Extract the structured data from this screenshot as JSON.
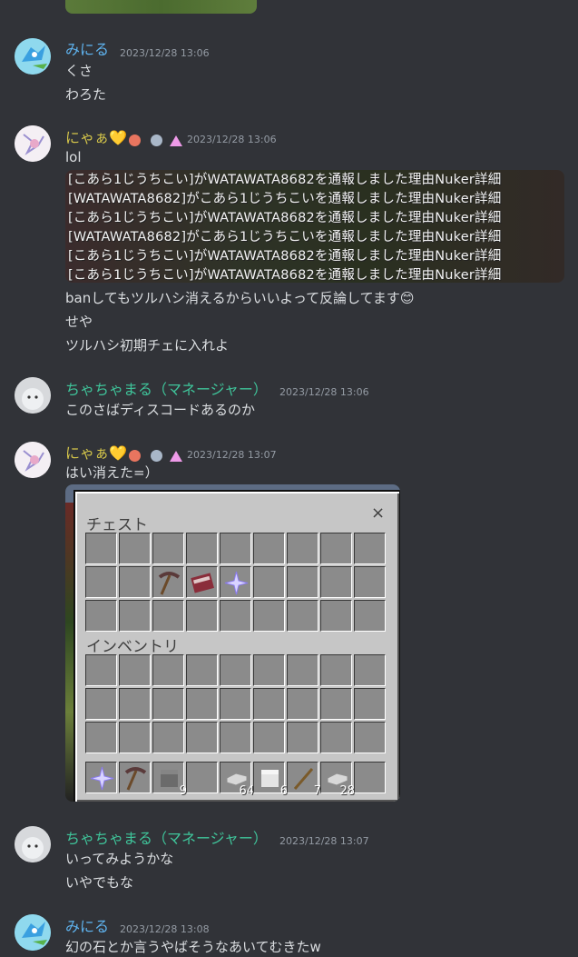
{
  "messages": [
    {
      "author": "みにる",
      "timestamp": "2023/12/28 13:06",
      "lines": [
        "くさ",
        "わろた"
      ]
    },
    {
      "author": "にゃぁ💛",
      "timestamp": "2023/12/28 13:06",
      "lines": [
        "lol",
        "banしてもツルハシ消えるからいいよって反論してます😊",
        "せや",
        "ツルハシ初期チェに入れよ"
      ],
      "log_lines": [
        "[こあら1じうちこい]がWATAWATA8682を通報しました理由Nuker詳細",
        "[WATAWATA8682]がこあら1じうちこいを通報しました理由Nuker詳細",
        "[こあら1じうちこい]がWATAWATA8682を通報しました理由Nuker詳細",
        "[WATAWATA8682]がこあら1じうちこいを通報しました理由Nuker詳細",
        "[こあら1じうちこい]がWATAWATA8682を通報しました理由Nuker詳細",
        "[こあら1じうちこい]がWATAWATA8682を通報しました理由Nuker詳細"
      ]
    },
    {
      "author": "ちゃちゃまる（マネージャー）",
      "timestamp": "2023/12/28 13:06",
      "lines": [
        "このさばディスコードあるのか"
      ]
    },
    {
      "author": "にゃぁ💛",
      "timestamp": "2023/12/28 13:07",
      "lines": [
        "はい消えた=）"
      ],
      "screenshot": {
        "chest_label": "チェスト",
        "inventory_label": "インベントリ",
        "close": "×",
        "hotbar_counts": [
          "9",
          "64",
          "6",
          "7",
          "28"
        ]
      }
    },
    {
      "author": "ちゃちゃまる（マネージャー）",
      "timestamp": "2023/12/28 13:07",
      "lines": [
        "いってみようかな",
        "いやでもな"
      ]
    },
    {
      "author": "みにる",
      "timestamp": "2023/12/28 13:08",
      "lines": [
        "幻の石とか言うやばそうなあいてむきたw"
      ]
    }
  ],
  "colors": {
    "background": "#313338",
    "blue_name": "#5fb4f0",
    "yellow_name": "#d3c44a",
    "green_name": "#3fc49a"
  }
}
